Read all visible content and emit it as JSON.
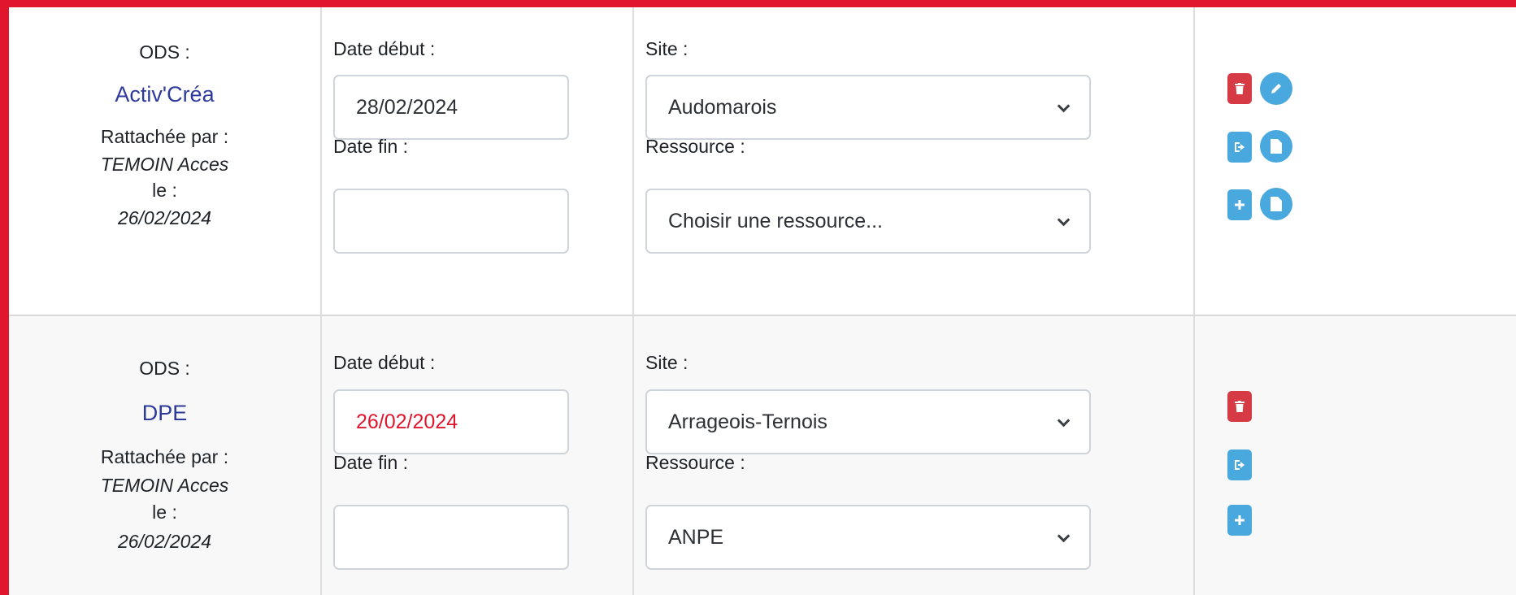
{
  "labels": {
    "ods": "ODS :",
    "attached_by": "Rattachée par :",
    "on": "le :",
    "date_start": "Date début :",
    "date_end": "Date fin :",
    "site": "Site :",
    "resource": "Ressource :"
  },
  "rows": [
    {
      "ods_name": "Activ'Créa",
      "attached_by": "TEMOIN Acces",
      "date": "26/02/2024",
      "date_start": "28/02/2024",
      "date_end": "",
      "site": "Audomarois",
      "resource": "Choisir une ressource...",
      "actions": [
        "trash-icon",
        "pencil-icon",
        "exit-icon",
        "document-icon",
        "plus-icon",
        "document-icon"
      ]
    },
    {
      "ods_name": "DPE",
      "attached_by": "TEMOIN Acces",
      "date": "26/02/2024",
      "date_start": "26/02/2024",
      "date_start_color": "#e1162d",
      "date_end": "",
      "site": "Arrageois-Ternois",
      "resource": "ANPE",
      "actions": [
        "trash-icon",
        "exit-icon",
        "plus-icon"
      ]
    }
  ],
  "colors": {
    "frame": "#e1162d",
    "delete": "#d63a45",
    "action": "#49a8dd",
    "ods_link": "#2d3a9c"
  }
}
